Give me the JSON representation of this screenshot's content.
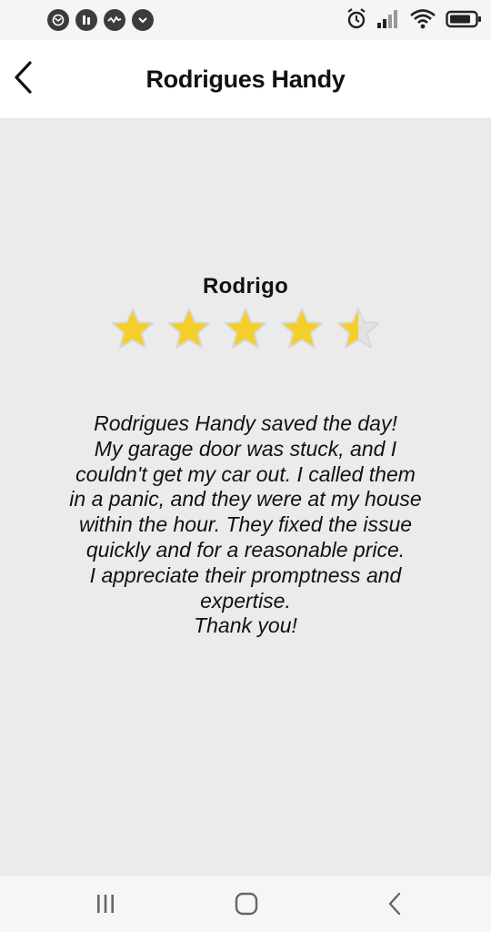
{
  "app_bar": {
    "title": "Rodrigues Handy"
  },
  "review": {
    "reviewer": "Rodrigo",
    "rating": 4.5,
    "rating_max": 5,
    "lines": [
      "Rodrigues Handy saved the day!",
      "My garage door was stuck, and I",
      "couldn't get my car out. I called them",
      "in a panic, and they were at my house",
      "within the hour. They fixed the issue",
      "quickly and for a reasonable price.",
      "I appreciate their promptness and",
      "expertise.",
      "Thank you!"
    ]
  },
  "icons": {
    "status_left": [
      "notification-icon",
      "app-icon",
      "activity-icon",
      "download-icon"
    ],
    "status_right": [
      "alarm-icon",
      "signal-icon",
      "wifi-icon",
      "battery-icon"
    ],
    "nav": [
      "recent-apps-icon",
      "home-icon",
      "back-icon"
    ]
  },
  "colors": {
    "star_fill": "#f4cf2a",
    "star_empty": "#e2e2e2",
    "content_bg": "#ebebeb"
  }
}
